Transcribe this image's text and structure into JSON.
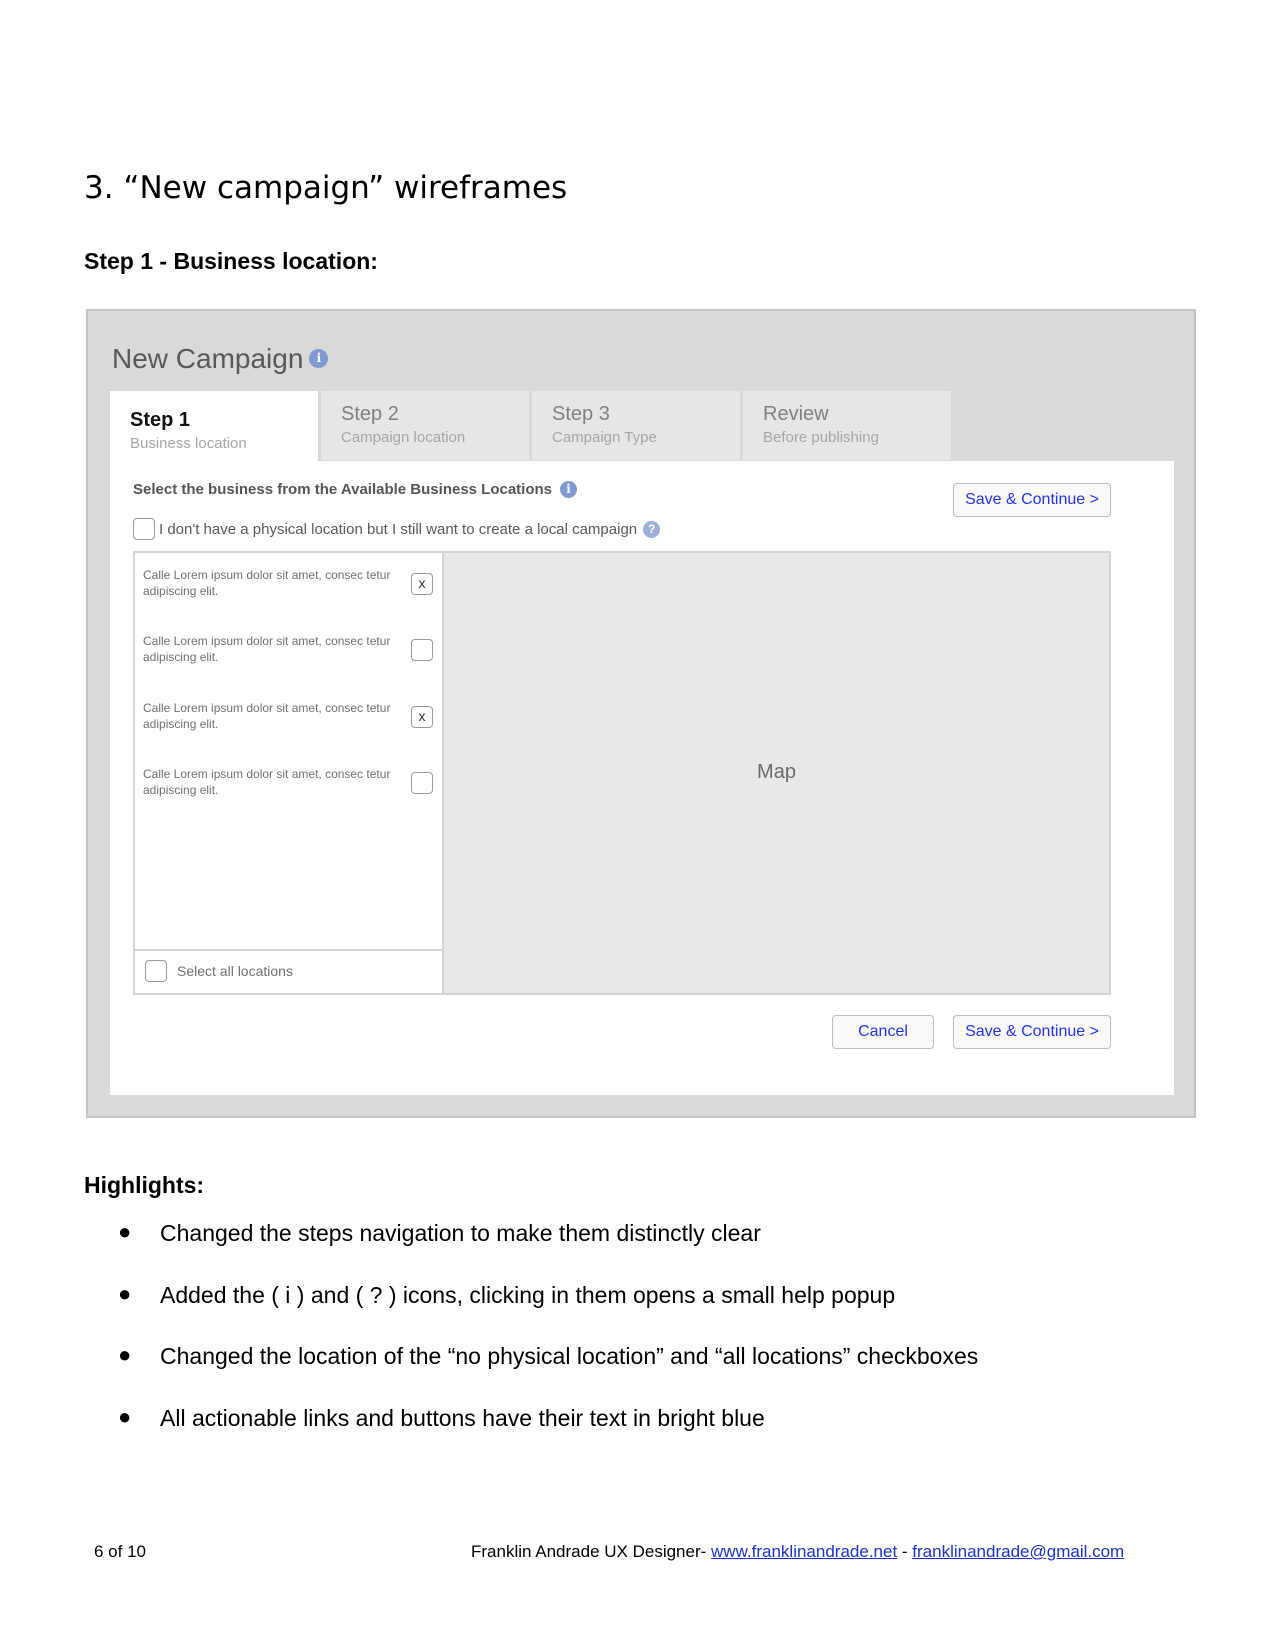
{
  "document": {
    "section_title": "3. “New campaign” wireframes",
    "step_heading": "Step 1 - Business location:",
    "highlights_heading": "Highlights:",
    "highlights": [
      "Changed the steps navigation to make them distinctly clear",
      "Added the ( i ) and ( ? ) icons, clicking in them opens a small help popup",
      "Changed the location of the “no physical location” and “all locations” checkboxes",
      "All actionable links and buttons have their text in bright blue"
    ],
    "bullet_glyph": "●"
  },
  "wireframe": {
    "title": "New Campaign",
    "info_glyph": "i",
    "help_glyph": "?",
    "tabs": [
      {
        "step": "Step 1",
        "sub": "Business location",
        "active": true
      },
      {
        "step": "Step 2",
        "sub": "Campaign location",
        "active": false
      },
      {
        "step": "Step 3",
        "sub": "Campaign Type",
        "active": false
      },
      {
        "step": "Review",
        "sub": "Before publishing",
        "active": false
      }
    ],
    "select_label": "Select the business from the Available Business Locations",
    "no_physical_label": "I don't have a physical location but I still want to create a local campaign",
    "save_continue_label": "Save & Continue >",
    "cancel_label": "Cancel",
    "locations": [
      {
        "text": "Calle Lorem ipsum dolor sit amet, consec tetur adipiscing elit.",
        "mark": "x"
      },
      {
        "text": "Calle Lorem ipsum dolor sit amet, consec tetur adipiscing elit.",
        "mark": ""
      },
      {
        "text": "Calle Lorem ipsum dolor sit amet, consec tetur adipiscing elit.",
        "mark": "x"
      },
      {
        "text": "Calle Lorem ipsum dolor sit amet, consec tetur adipiscing elit.",
        "mark": ""
      }
    ],
    "select_all_label": "Select all locations",
    "map_label": "Map"
  },
  "footer": {
    "page_number": "6 of 10",
    "author": "Franklin Andrade UX Designer- ",
    "website": "www.franklinandrade.net",
    "separator": " - ",
    "email": "franklinandrade@gmail.com"
  },
  "colors": {
    "link_blue": "#1a33cc",
    "button_text_blue": "#2233ee",
    "info_icon_blue": "#7f9bd1"
  }
}
